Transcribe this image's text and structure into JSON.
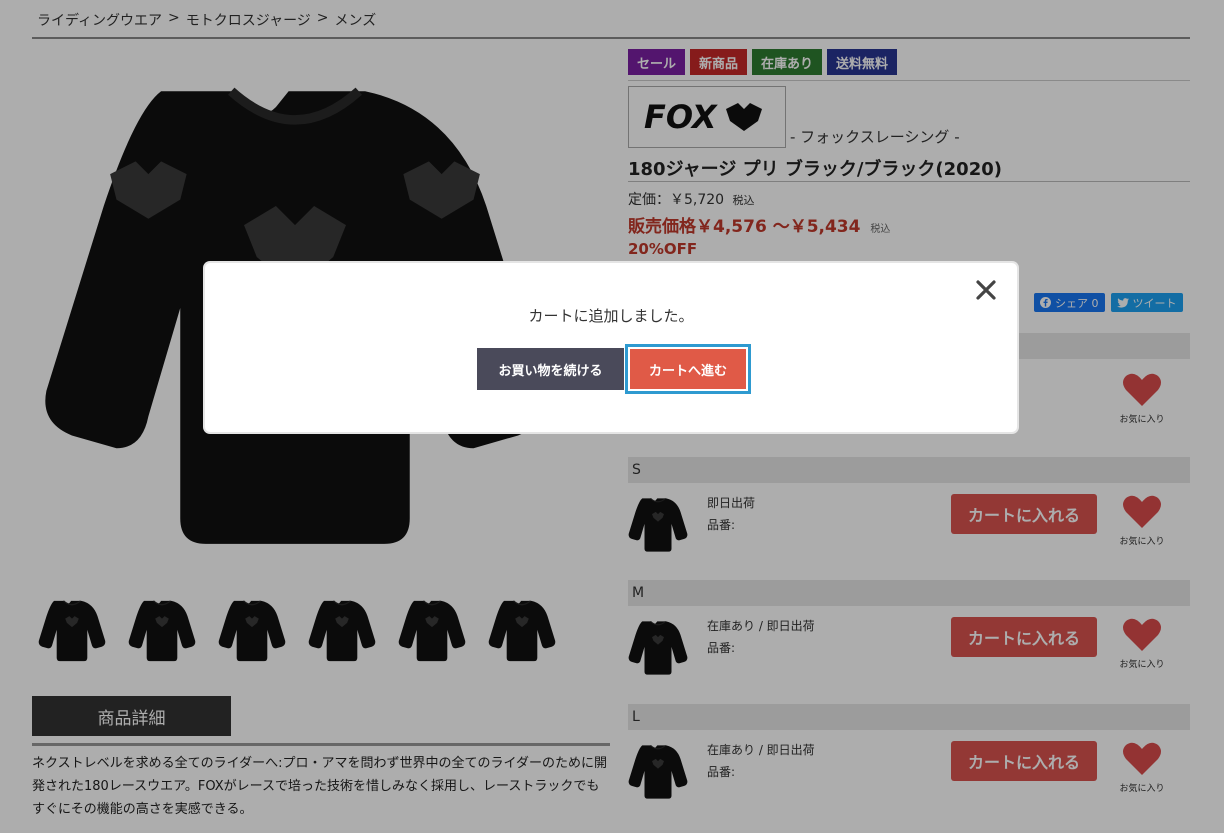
{
  "breadcrumb": {
    "items": [
      "ライディングウエア",
      "モトクロスジャージ",
      "メンズ"
    ],
    "separator": ">"
  },
  "gallery": {
    "main_image": "black-motocross-jersey",
    "thumbnail_count": 6
  },
  "details": {
    "tab_label": "商品詳細",
    "description": "ネクストレベルを求める全てのライダーへ:プロ・アマを問わず世界中の全てのライダーのために開発された180レースウエア。FOXがレースで培った技術を惜しみなく採用し、レーストラックでもすぐにその機能の高さを実感できる。"
  },
  "badges": {
    "sale": "セール",
    "new": "新商品",
    "in_stock": "在庫あり",
    "free_shipping": "送料無料"
  },
  "product": {
    "brand_logo_text": "FOX",
    "brand_name": "- フォックスレーシング -",
    "title": "180ジャージ プリ ブラック/ブラック(2020)",
    "list_price_label": "定価：￥5,720",
    "tax_label": "税込",
    "sale_price_label": "販売価格￥4,576 ～￥5,434",
    "discount": "20%OFF"
  },
  "social": {
    "share_label": "シェア 0",
    "tweet_label": "ツイート"
  },
  "sizes": [
    {
      "size": "S",
      "stock": "即日出荷",
      "code": "品番:",
      "cart_label": "カートに入れる",
      "fav_label": "お気に入り"
    },
    {
      "size": "M",
      "stock": "在庫あり / 即日出荷",
      "code": "品番:",
      "cart_label": "カートに入れる",
      "fav_label": "お気に入り"
    },
    {
      "size": "L",
      "stock": "在庫あり / 即日出荷",
      "code": "品番:",
      "cart_label": "カートに入れる",
      "fav_label": "お気に入り"
    }
  ],
  "first_fav_label": "お気に入り",
  "modal": {
    "message": "カートに追加しました。",
    "continue_label": "お買い物を続ける",
    "go_cart_label": "カートへ進む"
  },
  "colors": {
    "sale_red": "#c0392b",
    "cart_button": "#d9534f",
    "focus_ring": "#2e9ad0"
  }
}
